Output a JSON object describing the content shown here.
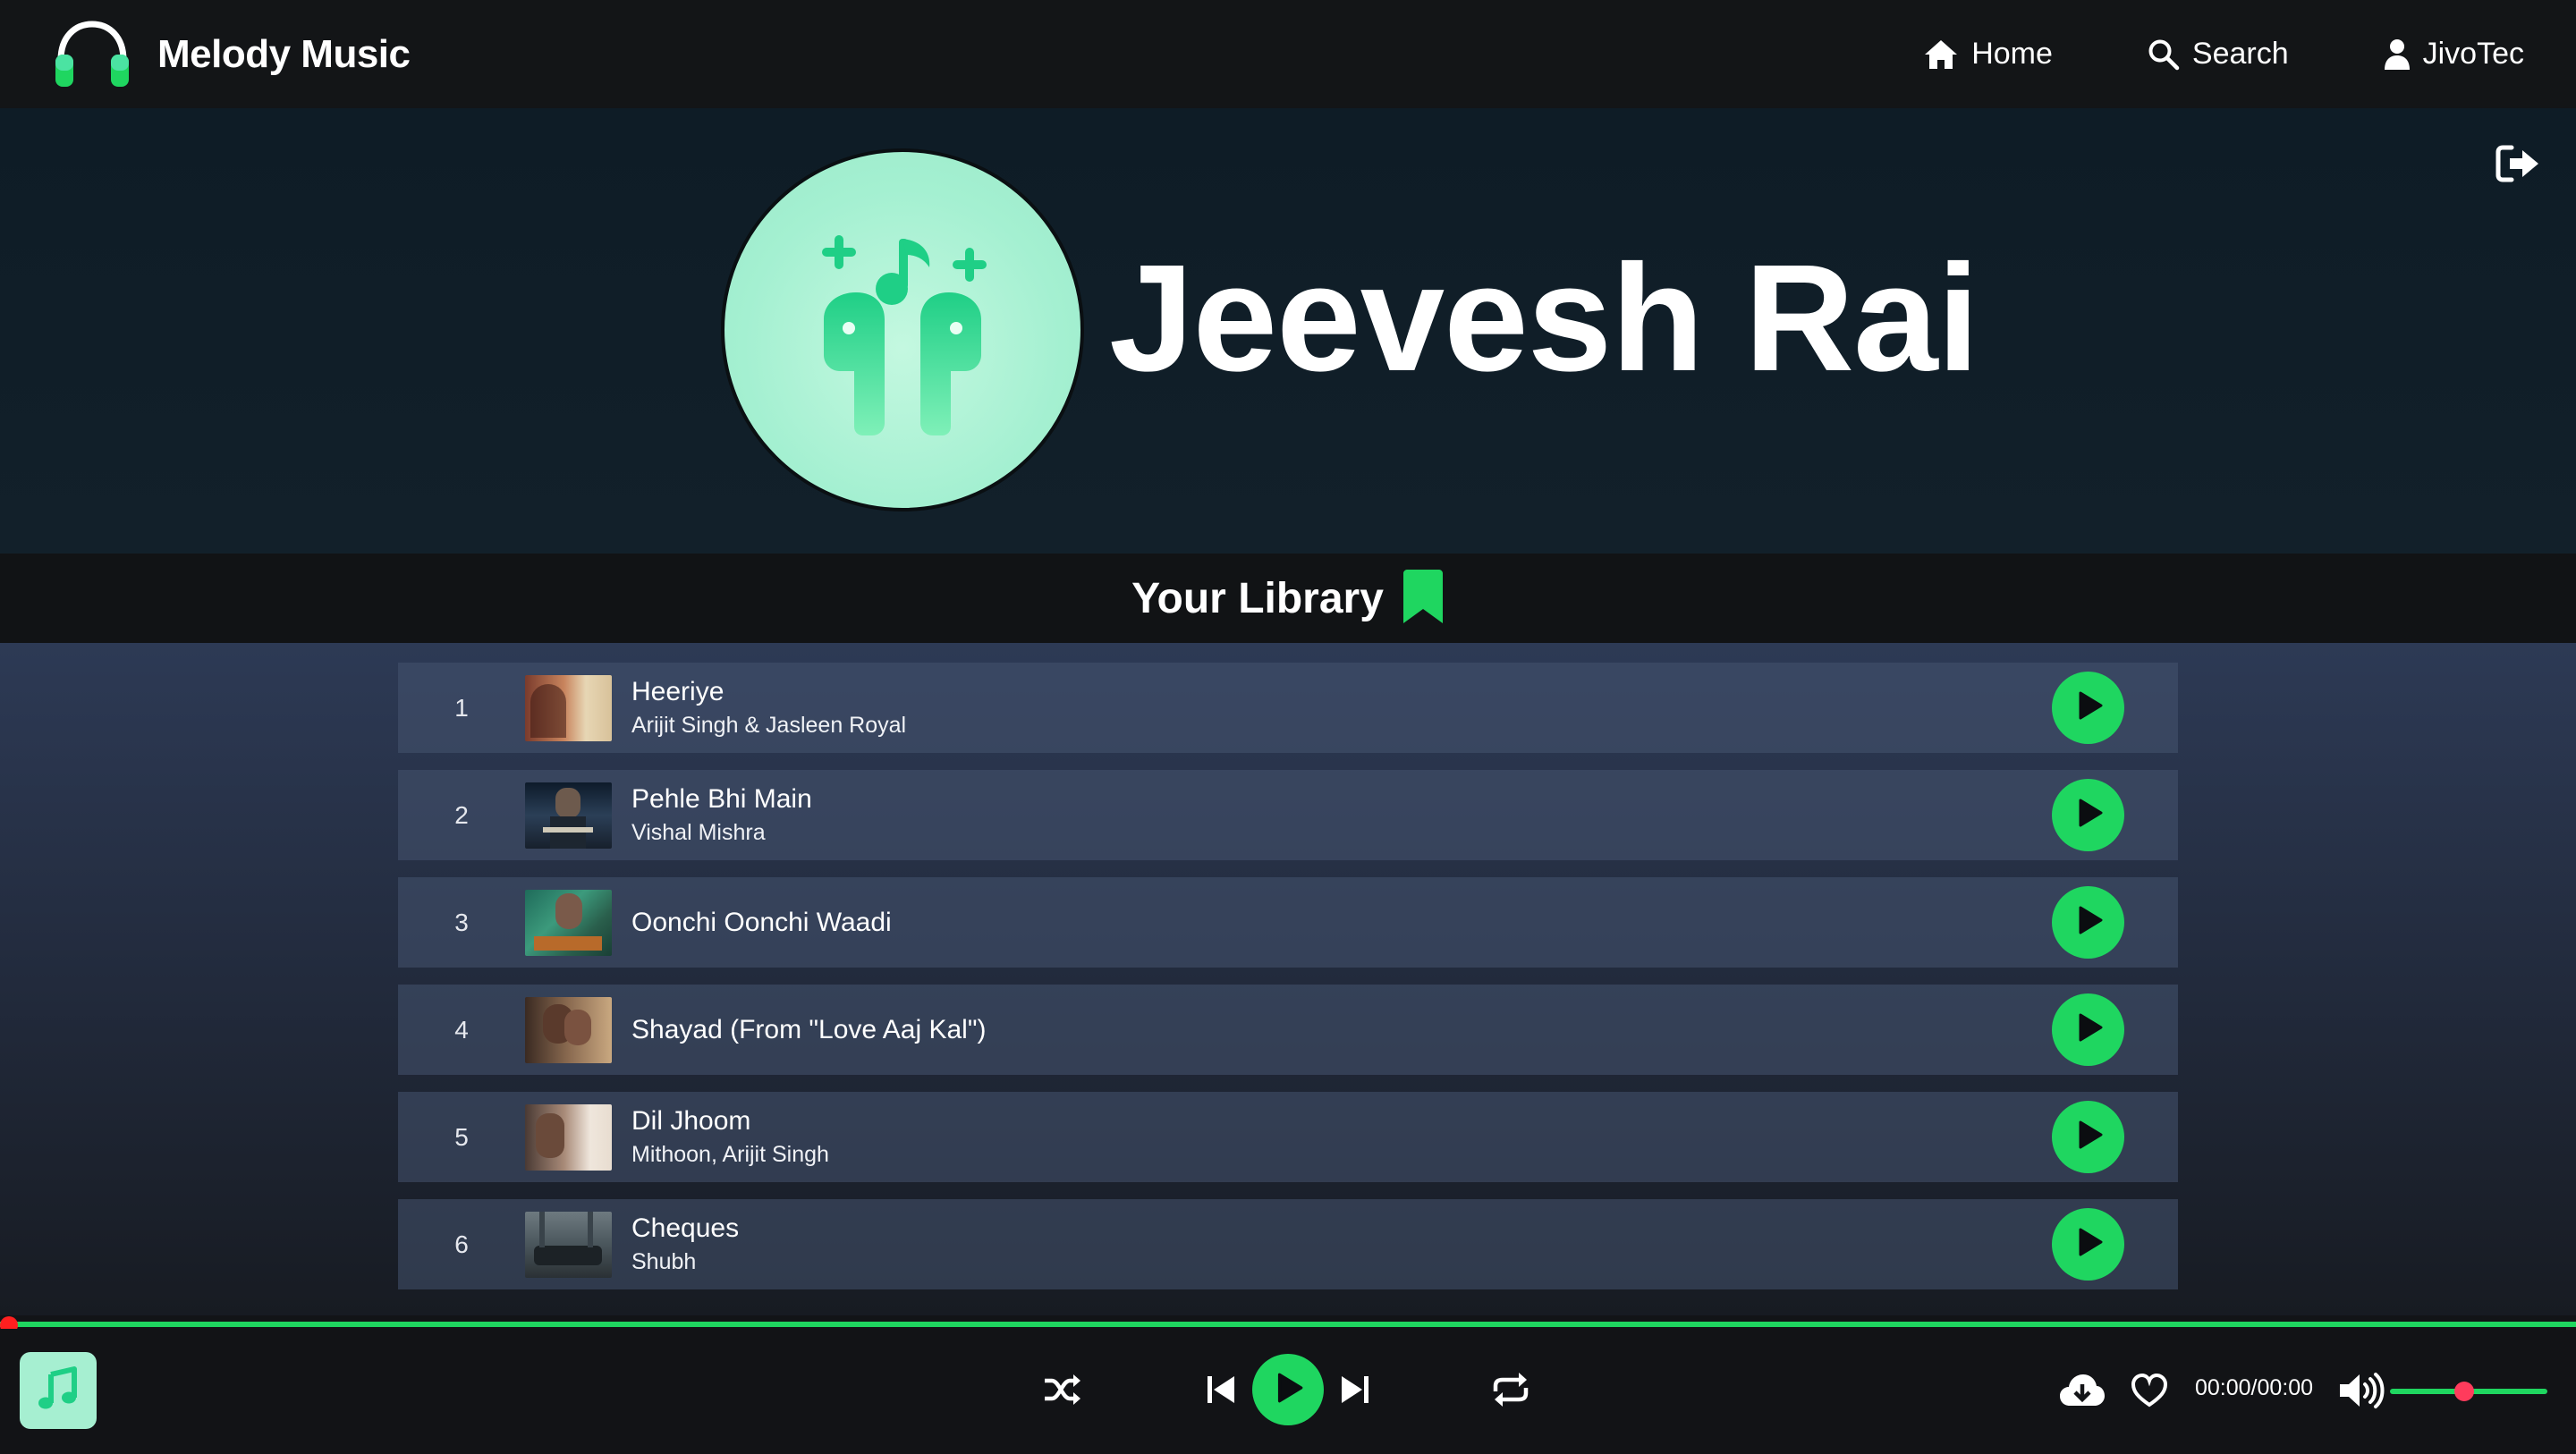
{
  "nav": {
    "brand": "Melody Music",
    "links": [
      {
        "label": "Home",
        "icon": "home-icon"
      },
      {
        "label": "Search",
        "icon": "search-icon"
      },
      {
        "label": "JivoTec",
        "icon": "user-icon"
      }
    ]
  },
  "profile": {
    "name": "Jeevesh Rai",
    "avatar_icon": "earbuds-music-icon"
  },
  "library": {
    "title": "Your Library",
    "icon": "bookmark-icon",
    "tracks": [
      {
        "num": "1",
        "title": "Heeriye",
        "artist": "Arijit Singh & Jasleen Royal"
      },
      {
        "num": "2",
        "title": "Pehle Bhi Main",
        "artist": "Vishal Mishra"
      },
      {
        "num": "3",
        "title": "Oonchi Oonchi Waadi",
        "artist": ""
      },
      {
        "num": "4",
        "title": "Shayad (From \"Love Aaj Kal\")",
        "artist": ""
      },
      {
        "num": "5",
        "title": "Dil Jhoom",
        "artist": "Mithoon, Arijit Singh"
      },
      {
        "num": "6",
        "title": "Cheques",
        "artist": "Shubh"
      }
    ]
  },
  "player": {
    "time": "00:00/00:00",
    "progress_fraction": 0,
    "volume_fraction": 0.47
  },
  "colors": {
    "accent": "#1fd660",
    "mint": "#a6efd1",
    "knob": "#ff1f1f",
    "volume_knob": "#ff3b5c"
  }
}
